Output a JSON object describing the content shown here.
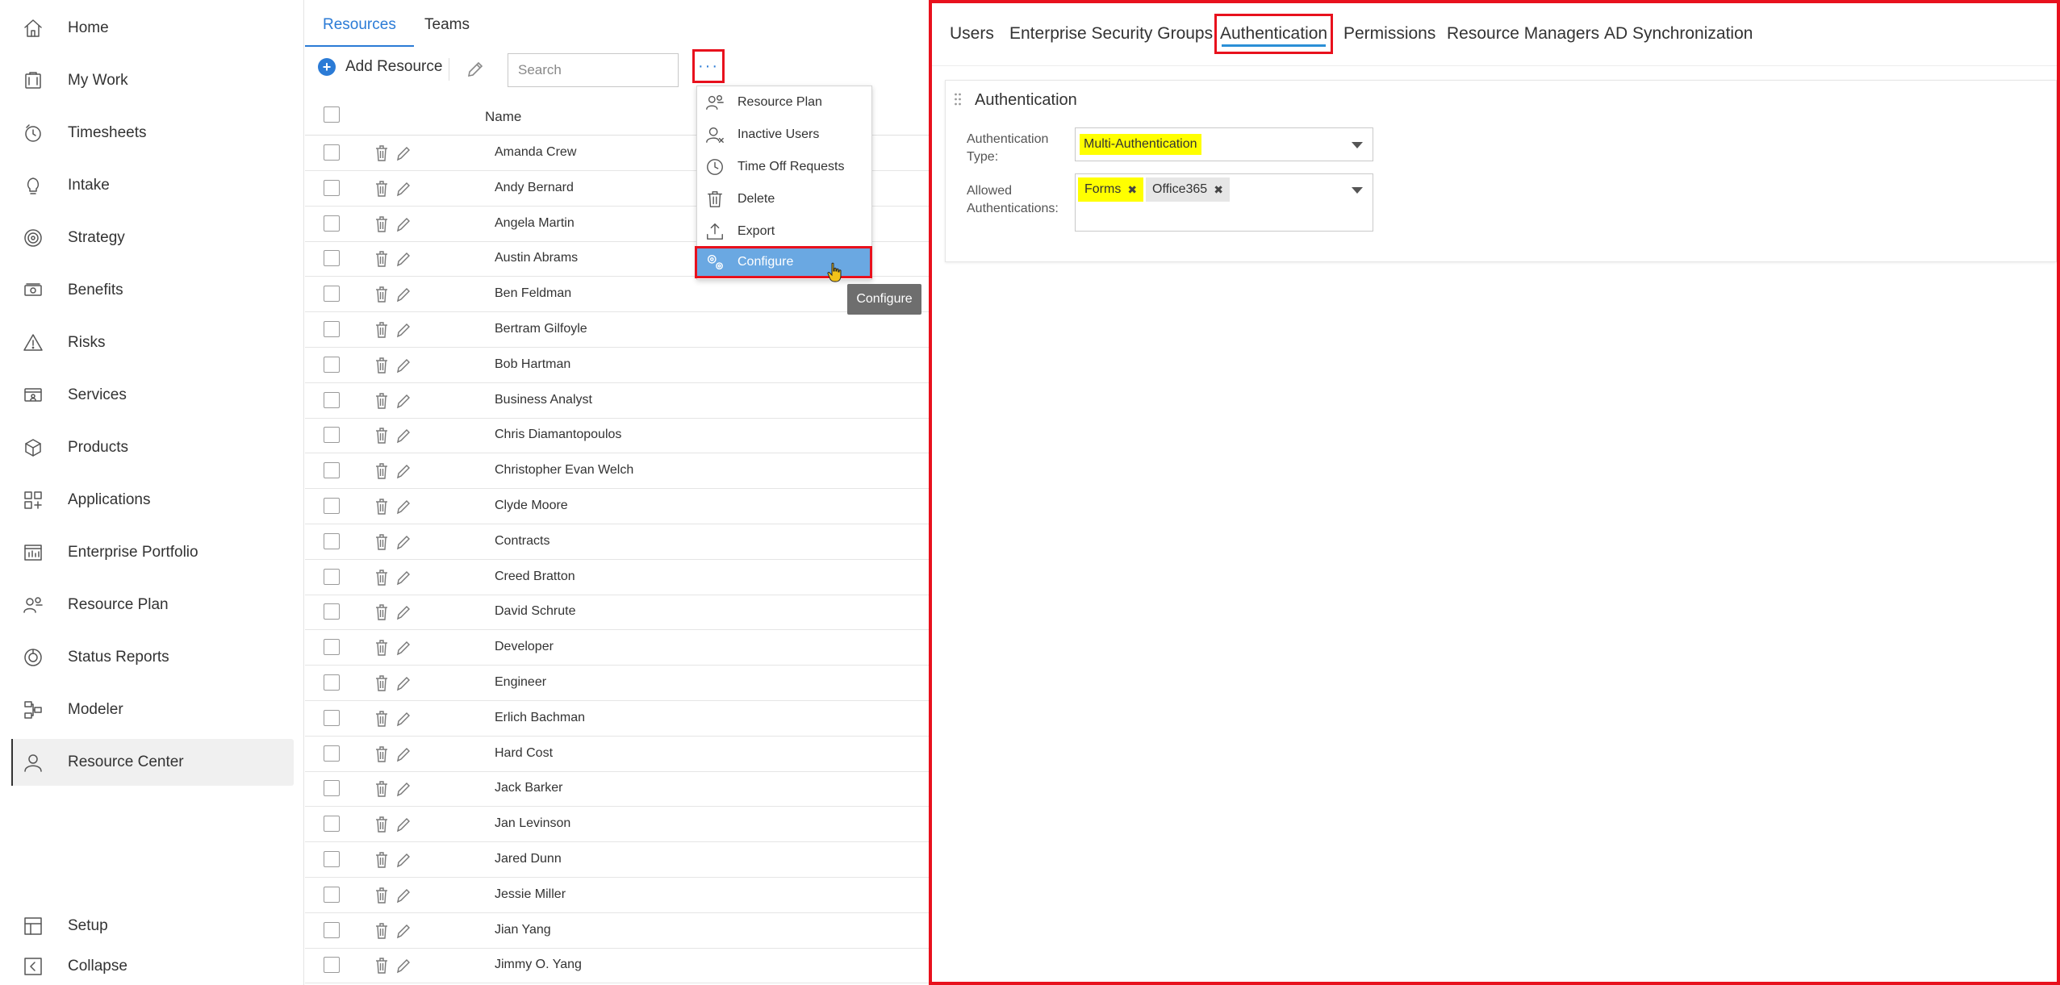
{
  "sidebar": {
    "items": [
      {
        "label": "Home",
        "icon": "home-icon"
      },
      {
        "label": "My Work",
        "icon": "my-work-icon"
      },
      {
        "label": "Timesheets",
        "icon": "timesheets-icon"
      },
      {
        "label": "Intake",
        "icon": "lightbulb-icon"
      },
      {
        "label": "Strategy",
        "icon": "target-icon"
      },
      {
        "label": "Benefits",
        "icon": "money-icon"
      },
      {
        "label": "Risks",
        "icon": "warning-icon"
      },
      {
        "label": "Services",
        "icon": "services-icon"
      },
      {
        "label": "Products",
        "icon": "products-icon"
      },
      {
        "label": "Applications",
        "icon": "applications-icon"
      },
      {
        "label": "Enterprise Portfolio",
        "icon": "portfolio-icon"
      },
      {
        "label": "Resource Plan",
        "icon": "resource-plan-icon"
      },
      {
        "label": "Status Reports",
        "icon": "status-reports-icon"
      },
      {
        "label": "Modeler",
        "icon": "modeler-icon"
      },
      {
        "label": "Resource Center",
        "icon": "user-icon",
        "active": true
      }
    ],
    "bottom": [
      {
        "label": "Setup",
        "icon": "setup-icon"
      },
      {
        "label": "Collapse",
        "icon": "collapse-icon"
      }
    ]
  },
  "list_panel": {
    "tabs": [
      {
        "label": "Resources",
        "active": true
      },
      {
        "label": "Teams",
        "active": false
      }
    ],
    "add_resource_label": "Add Resource",
    "search_placeholder": "Search",
    "more_label": "···",
    "name_header": "Name",
    "rows": [
      "Amanda Crew",
      "Andy Bernard",
      "Angela Martin",
      "Austin Abrams",
      "Ben Feldman",
      "Bertram Gilfoyle",
      "Bob Hartman",
      "Business Analyst",
      "Chris Diamantopoulos",
      "Christopher Evan Welch",
      "Clyde Moore",
      "Contracts",
      "Creed Bratton",
      "David Schrute",
      "Developer",
      "Engineer",
      "Erlich Bachman",
      "Hard Cost",
      "Jack Barker",
      "Jan Levinson",
      "Jared Dunn",
      "Jessie Miller",
      "Jian Yang",
      "Jimmy O. Yang"
    ]
  },
  "more_menu": {
    "items": [
      {
        "label": "Resource Plan",
        "icon": "resource-plan-icon"
      },
      {
        "label": "Inactive Users",
        "icon": "inactive-users-icon"
      },
      {
        "label": "Time Off Requests",
        "icon": "clock-icon"
      },
      {
        "label": "Delete",
        "icon": "trash-icon"
      },
      {
        "label": "Export",
        "icon": "export-icon"
      },
      {
        "label": "Configure",
        "icon": "gears-icon",
        "selected": true
      }
    ],
    "tooltip": "Configure"
  },
  "config": {
    "tabs": [
      {
        "label": "Users"
      },
      {
        "label": "Enterprise Security Groups"
      },
      {
        "label": "Authentication",
        "active": true
      },
      {
        "label": "Permissions"
      },
      {
        "label": "Resource Managers"
      },
      {
        "label": "AD Synchronization"
      }
    ],
    "card_title": "Authentication",
    "auth_type_label_1": "Authentication",
    "auth_type_label_2": "Type:",
    "auth_type_value": "Multi-Authentication",
    "allowed_label_1": "Allowed",
    "allowed_label_2": "Authentications:",
    "allowed_values": [
      "Forms",
      "Office365"
    ]
  },
  "colors": {
    "accent": "#2b7bd6",
    "highlight_box": "#e8111d",
    "highlight_text": "#ffff00",
    "menu_selected": "#6aa8e2"
  }
}
